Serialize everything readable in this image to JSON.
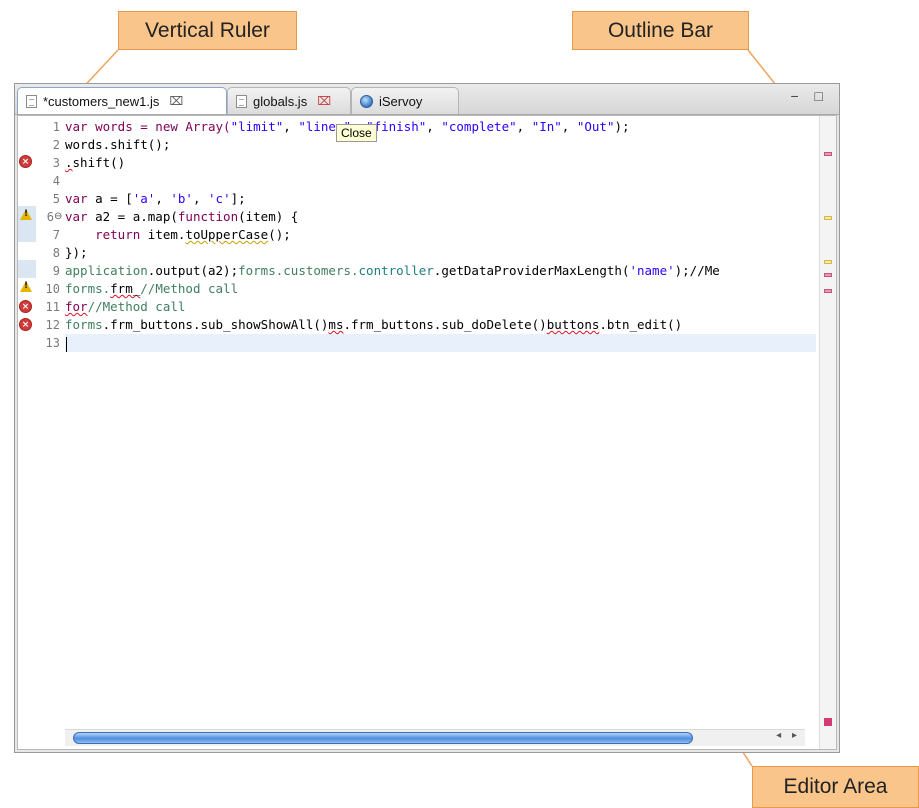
{
  "callouts": {
    "vertical_ruler": "Vertical Ruler",
    "outline_bar": "Outline Bar",
    "editor_area": "Editor Area"
  },
  "tabs": [
    {
      "label": "*customers_new1.js",
      "close": "⌧",
      "active": true
    },
    {
      "label": "globals.js",
      "close": "⌧",
      "active": false
    },
    {
      "label": "iServoy",
      "active": false
    }
  ],
  "window_controls": "− □",
  "tooltip": "Close",
  "line_numbers": [
    "1",
    "2",
    "3",
    "4",
    "5",
    "6",
    "7",
    "8",
    "9",
    "10",
    "11",
    "12",
    "13"
  ],
  "code": {
    "l1": {
      "a": "var words = new Array(",
      "s1": "\"limit\"",
      "c1": ", ",
      "s2": "\"lines\"",
      "c2": ", ",
      "s3": "\"finish\"",
      "c3": ", ",
      "s4": "\"complete\"",
      "c4": ", ",
      "s5": "\"In\"",
      "c5": ", ",
      "s6": "\"Out\"",
      "end": ");"
    },
    "l2": "words.shift();",
    "l3": {
      "pre": ".",
      "rest": "shift()"
    },
    "l5": {
      "kw": "var",
      "mid": " a = [",
      "s1": "'a'",
      "c1": ", ",
      "s2": "'b'",
      "c2": ", ",
      "s3": "'c'",
      "end": "];"
    },
    "l6": {
      "kw": "var",
      "mid": " a2 = a.map(",
      "kw2": "function",
      "end": "(item) {"
    },
    "l7": {
      "indent": "    ",
      "kw": "return",
      "mid": " item.",
      "sq": "toUpperCase",
      "end": "();"
    },
    "l8": "});",
    "l9": {
      "app": "application",
      "mid": ".output(a2);",
      "forms": "forms.customers.",
      "ctrl": "controller",
      "mid2": ".getDataProviderMaxLength(",
      "str": "'name'",
      "end": ");//Me"
    },
    "l10": {
      "forms": "forms.",
      "sq": "frm_",
      "cmt": "//Method call"
    },
    "l11": {
      "sq": "for",
      "cmt": "//Method call"
    },
    "l12": {
      "forms": "forms",
      "a": ".frm_buttons.sub_showShowAll()",
      "sq1": "ms",
      "b": ".frm_buttons.sub_doDelete()",
      "sq2": "buttons",
      "c": ".btn_edit()"
    }
  },
  "markers": [
    {
      "line": "3",
      "type": "error",
      "glyph": "×"
    },
    {
      "line": "7",
      "type": "warning",
      "glyph": "!"
    },
    {
      "line": "10",
      "type": "warning",
      "glyph": "!"
    },
    {
      "line": "11",
      "type": "error",
      "glyph": "×"
    },
    {
      "line": "12",
      "type": "error",
      "glyph": "×"
    }
  ],
  "scroll_arrows": "◂ ▸",
  "colors": {
    "keyword": "#7f0055",
    "string": "#2a00ff",
    "comment": "#3f7f5f",
    "callout_fill": "#f9c58a",
    "callout_border": "#e89a4a",
    "error": "#d33a3a",
    "warning": "#e7b400"
  }
}
